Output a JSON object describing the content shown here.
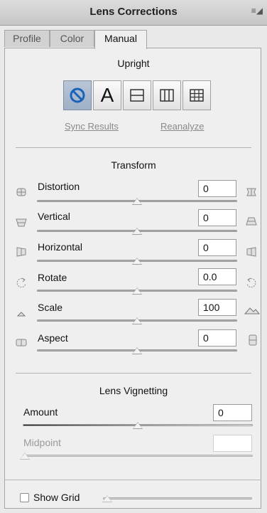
{
  "window": {
    "title": "Lens Corrections",
    "menu_glyph": "≡◢"
  },
  "tabs": [
    {
      "label": "Profile",
      "active": false
    },
    {
      "label": "Color",
      "active": false
    },
    {
      "label": "Manual",
      "active": true
    }
  ],
  "upright": {
    "heading": "Upright",
    "buttons": [
      {
        "name": "off",
        "glyph": "⃠",
        "selected": true
      },
      {
        "name": "auto",
        "glyph": "A",
        "selected": false
      },
      {
        "name": "level",
        "selected": false
      },
      {
        "name": "vertical",
        "selected": false
      },
      {
        "name": "full",
        "selected": false
      }
    ],
    "sync_label": "Sync Results",
    "reanalyze_label": "Reanalyze"
  },
  "transform": {
    "heading": "Transform",
    "rows": [
      {
        "label": "Distortion",
        "value": "0",
        "position": 0.5
      },
      {
        "label": "Vertical",
        "value": "0",
        "position": 0.5
      },
      {
        "label": "Horizontal",
        "value": "0",
        "position": 0.5
      },
      {
        "label": "Rotate",
        "value": "0.0",
        "position": 0.5
      },
      {
        "label": "Scale",
        "value": "100",
        "position": 0.5
      },
      {
        "label": "Aspect",
        "value": "0",
        "position": 0.5
      }
    ]
  },
  "vignetting": {
    "heading": "Lens Vignetting",
    "amount_label": "Amount",
    "amount_value": "0",
    "amount_position": 0.5,
    "midpoint_label": "Midpoint",
    "midpoint_value": "",
    "midpoint_position": 0.0
  },
  "show_grid": {
    "label": "Show Grid",
    "checked": false,
    "grid_size_position": 0.0
  }
}
